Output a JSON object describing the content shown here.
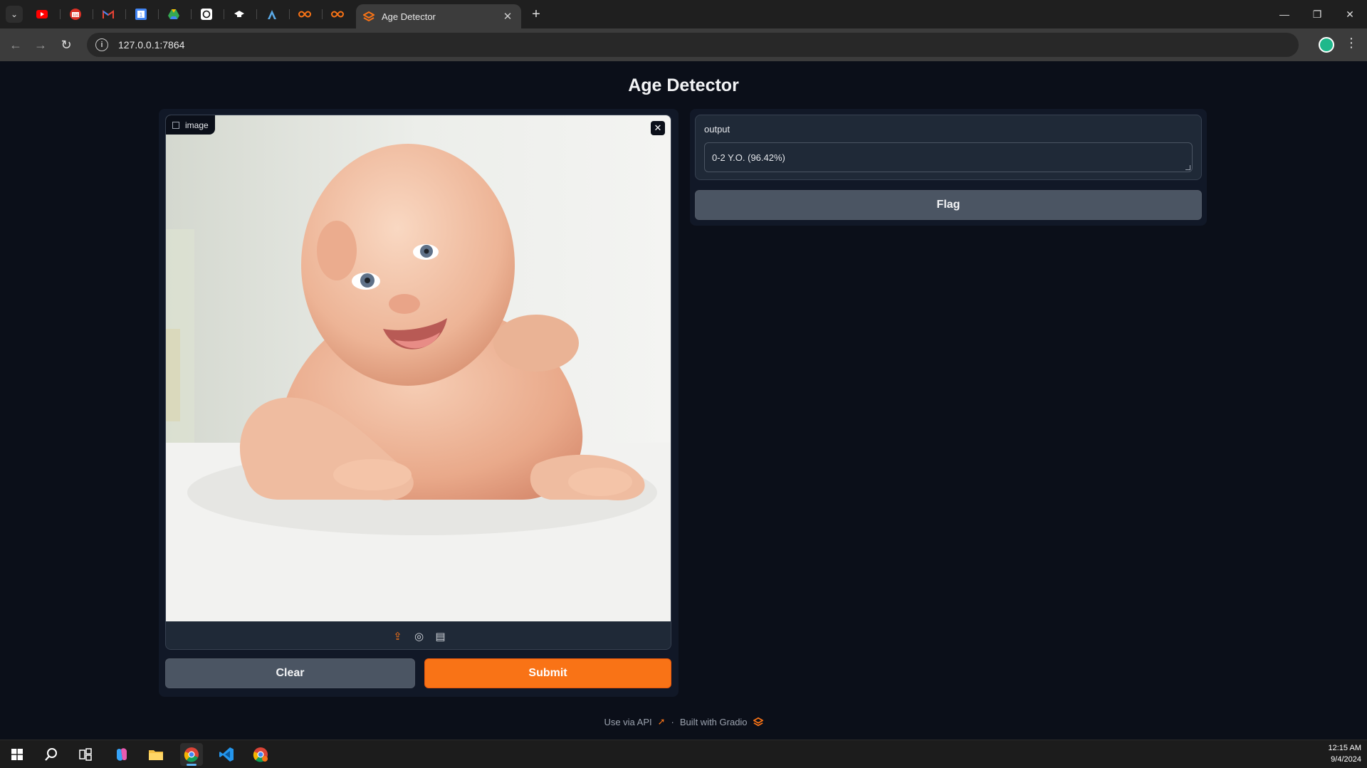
{
  "browser": {
    "active_tab_title": "Age Detector",
    "pinned_tabs": [
      {
        "icon": "youtube-icon",
        "color": "#ff0000"
      },
      {
        "icon": "calendar-badge-icon",
        "color": "#d93025",
        "badge": "116"
      },
      {
        "icon": "gmail-icon",
        "color": "#ea4335"
      },
      {
        "icon": "google-calendar-icon",
        "color": "#4285f4"
      },
      {
        "icon": "google-drive-icon",
        "color": "#34a853"
      },
      {
        "icon": "chatgpt-icon",
        "color": "#ffffff"
      },
      {
        "icon": "graduation-cap-icon",
        "color": "#ffffff"
      },
      {
        "icon": "app-icon",
        "color": "#5aa9e6"
      },
      {
        "icon": "infinity-icon",
        "color": "#f97316"
      },
      {
        "icon": "infinity-icon",
        "color": "#f97316"
      }
    ],
    "url": "127.0.0.1:7864"
  },
  "app": {
    "title": "Age Detector",
    "image_label": "image",
    "output_label": "output",
    "output_value": "0-2 Y.O. (96.42%)",
    "clear_label": "Clear",
    "submit_label": "Submit",
    "flag_label": "Flag",
    "accent": "#f97316"
  },
  "footer": {
    "api_label": "Use via API",
    "separator": "·",
    "built_label": "Built with Gradio"
  },
  "taskbar": {
    "time": "12:15 AM",
    "date": "9/4/2024"
  }
}
